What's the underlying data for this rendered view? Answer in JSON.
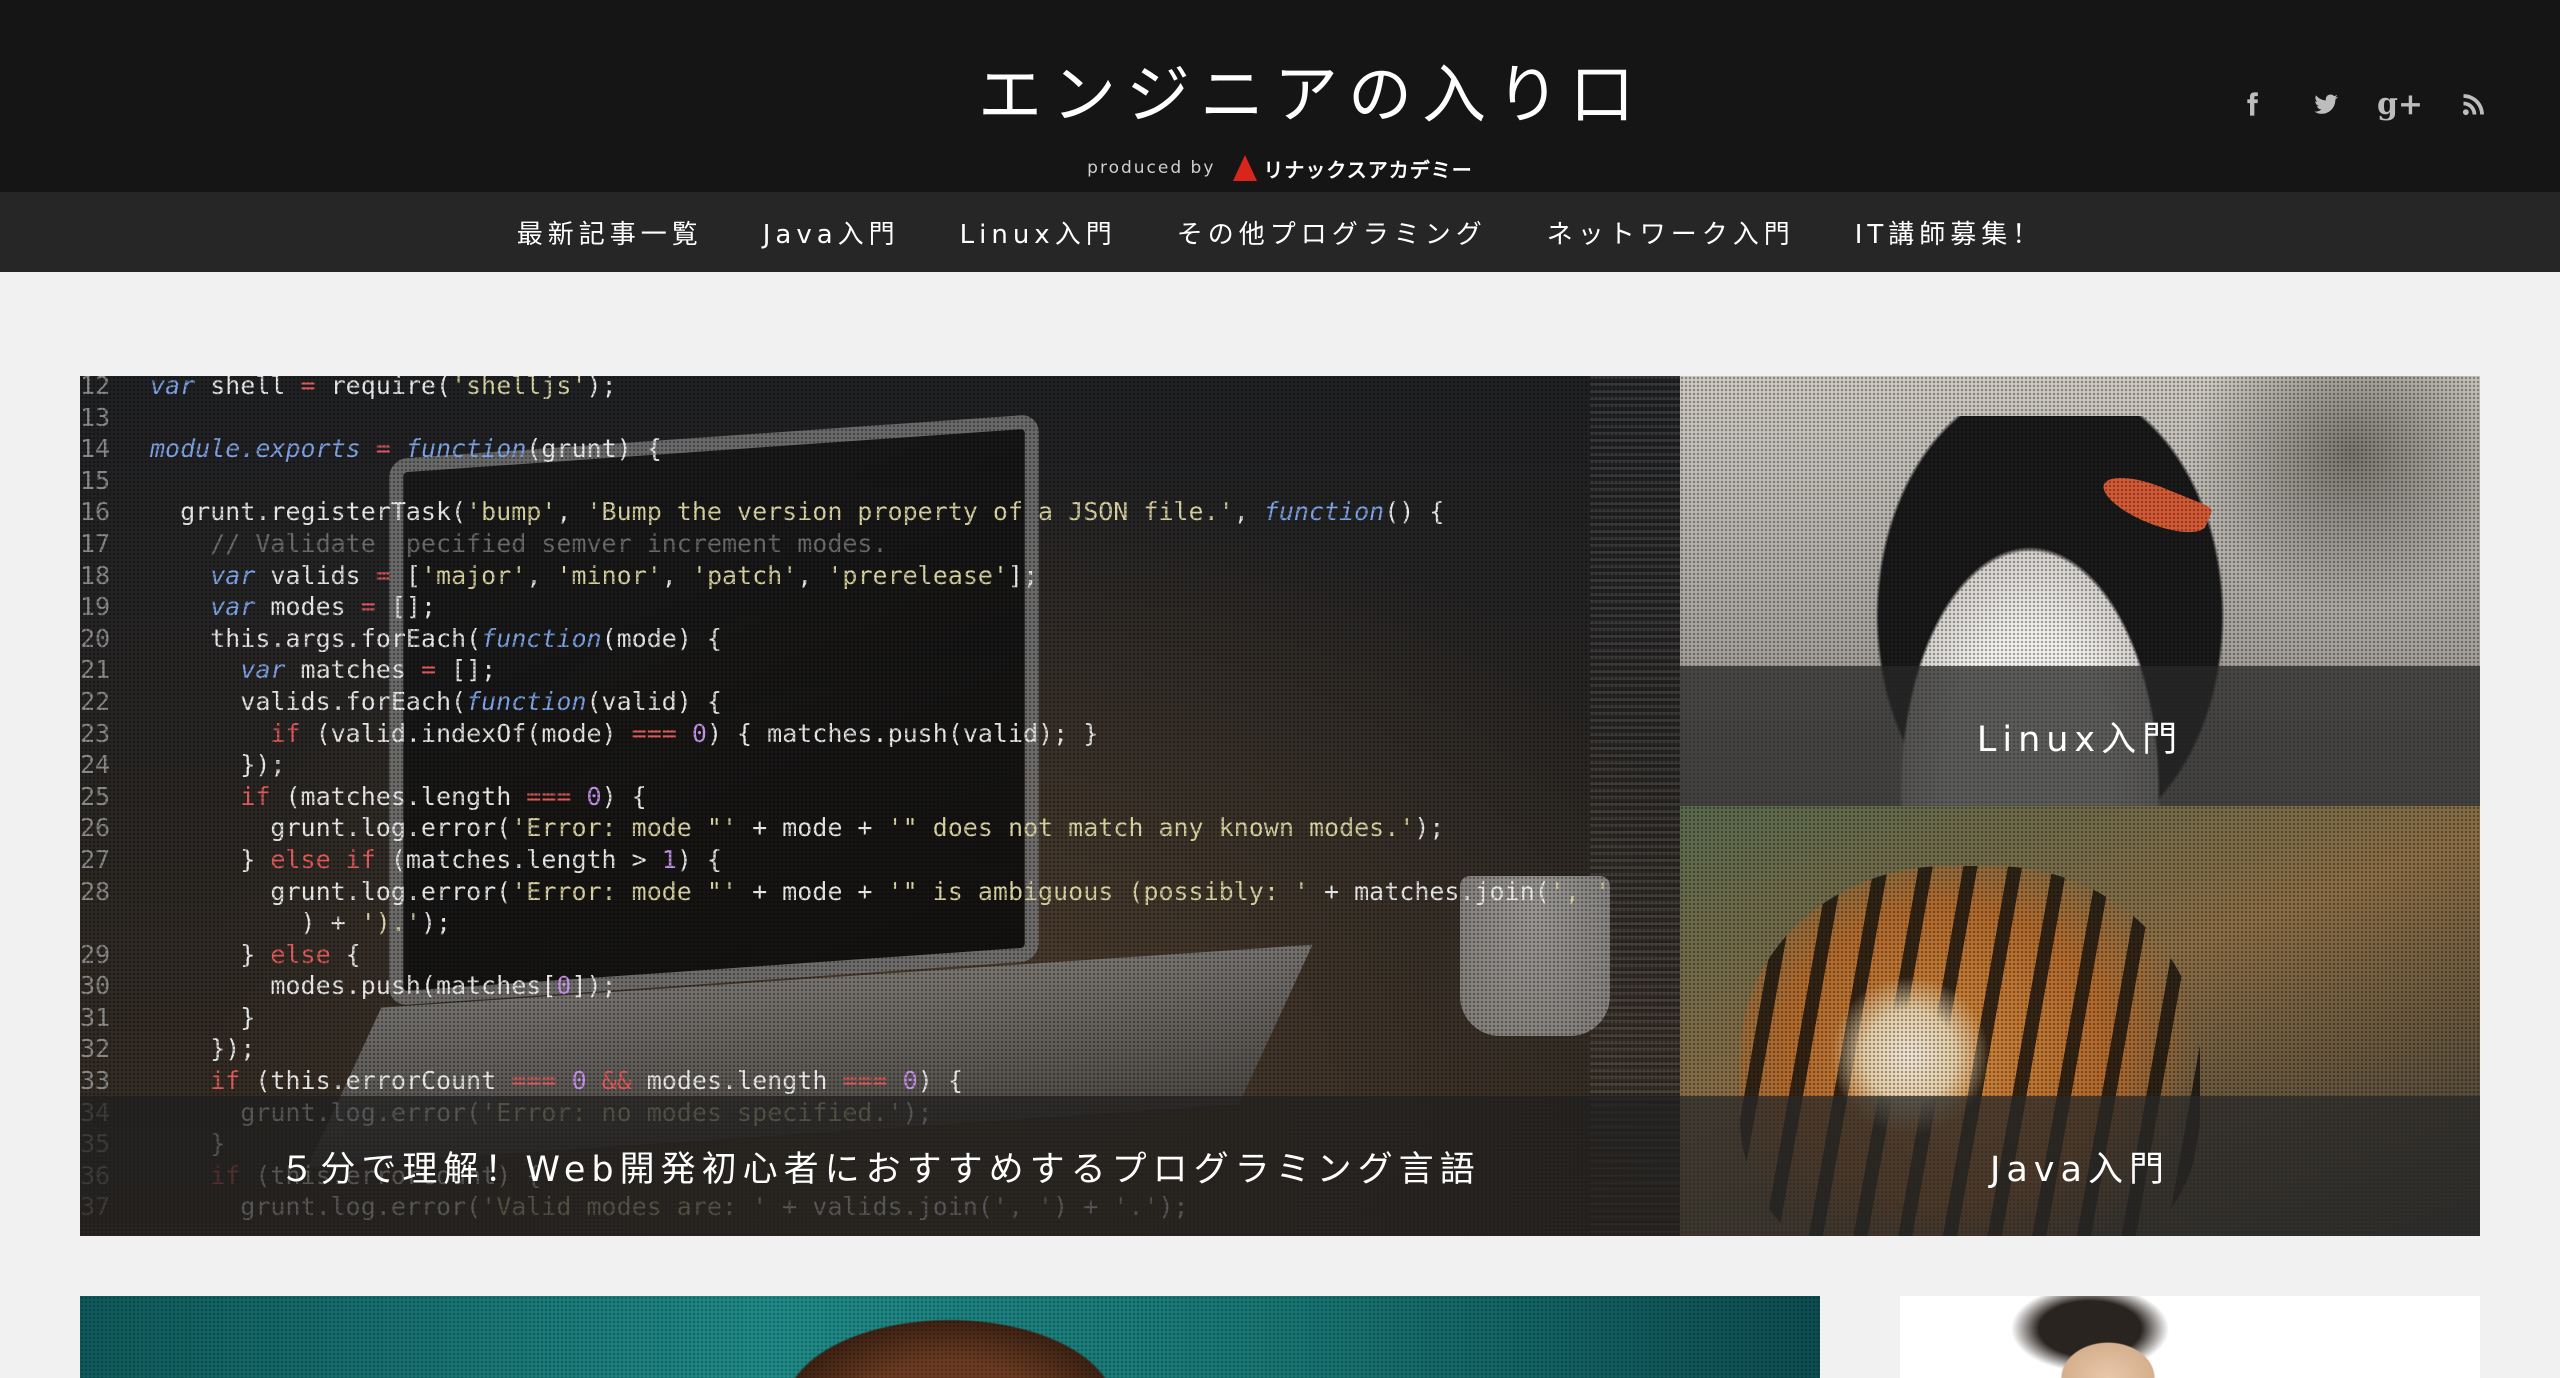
{
  "header": {
    "logo_title": "エンジニアの入り口",
    "produced_by": "produced by",
    "brand_name": "リナックスアカデミー",
    "social": [
      {
        "icon": "facebook-icon"
      },
      {
        "icon": "twitter-icon"
      },
      {
        "icon": "google-plus-icon"
      },
      {
        "icon": "rss-icon"
      }
    ]
  },
  "nav": {
    "items": [
      {
        "label": "最新記事一覧"
      },
      {
        "label": "Java入門"
      },
      {
        "label": "Linux入門"
      },
      {
        "label": "その他プログラミング"
      },
      {
        "label": "ネットワーク入門"
      },
      {
        "label": "IT講師募集！"
      }
    ]
  },
  "featured": {
    "main": {
      "caption": "５分で理解！Web開発初心者におすすめするプログラミング言語"
    },
    "side": [
      {
        "caption": "Linux入門"
      },
      {
        "caption": "Java入門"
      }
    ]
  },
  "colors": {
    "header_bg": "#151515",
    "nav_bg": "#262626",
    "page_bg": "#f1f1f1",
    "brand_accent": "#d9261c"
  }
}
